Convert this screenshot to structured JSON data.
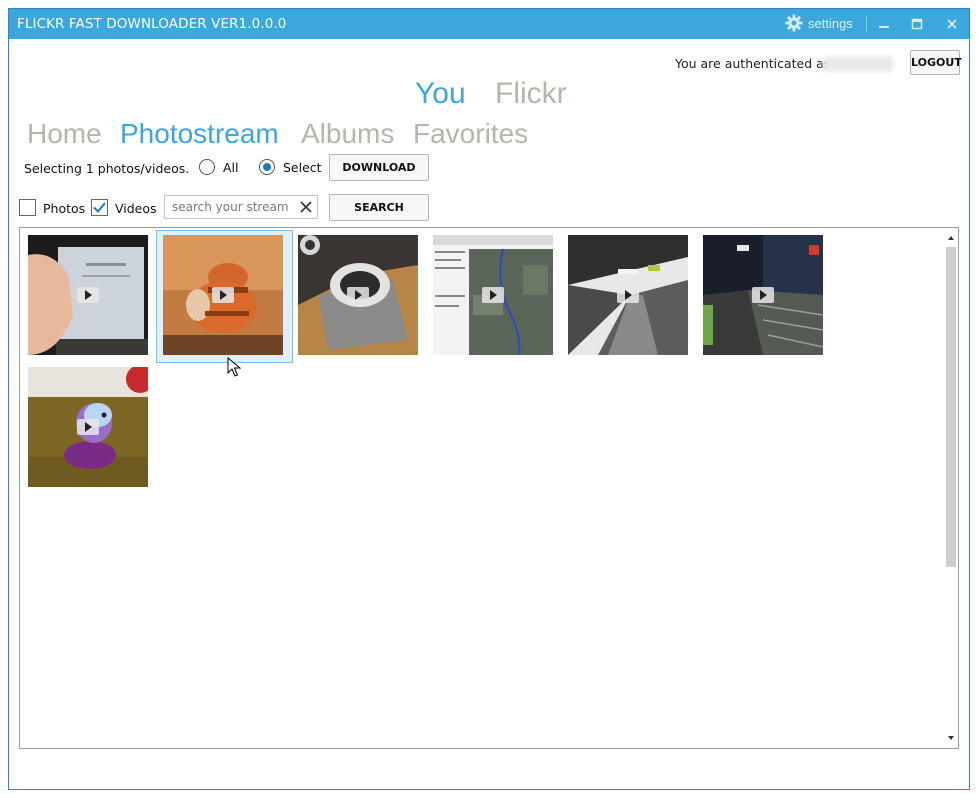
{
  "window": {
    "title": "FLICKR FAST DOWNLOADER VER1.0.0.0",
    "settings_label": "settings",
    "controls": [
      "minimize-icon",
      "maximize-icon",
      "close-icon"
    ],
    "accent_color": "#3aa7dd"
  },
  "auth": {
    "text": "You are authenticated as",
    "logout_label": "LOGOUT"
  },
  "top_tabs": [
    {
      "label": "You",
      "active": true
    },
    {
      "label": "Flickr",
      "active": false
    }
  ],
  "main_tabs": [
    {
      "label": "Home",
      "active": false
    },
    {
      "label": "Photostream",
      "active": true
    },
    {
      "label": "Albums",
      "active": false
    },
    {
      "label": "Favorites",
      "active": false
    }
  ],
  "selection": {
    "status": "Selecting 1 photos/videos.",
    "options": [
      {
        "label": "All",
        "checked": false
      },
      {
        "label": "Select",
        "checked": true
      }
    ],
    "download_label": "DOWNLOAD"
  },
  "filters": {
    "photos": {
      "label": "Photos",
      "checked": false
    },
    "videos": {
      "label": "Videos",
      "checked": true
    },
    "search_placeholder": "search your stream",
    "search_label": "SEARCH"
  },
  "thumbnails": [
    {
      "name": "thumb-laptop-video",
      "selected": false
    },
    {
      "name": "thumb-orange-figure-video",
      "selected": true
    },
    {
      "name": "thumb-robot-vacuum-video",
      "selected": false
    },
    {
      "name": "thumb-map-software-video",
      "selected": false
    },
    {
      "name": "thumb-station-platform-video",
      "selected": false
    },
    {
      "name": "thumb-night-platform-video",
      "selected": false
    },
    {
      "name": "thumb-purple-toy-video",
      "selected": false
    }
  ]
}
